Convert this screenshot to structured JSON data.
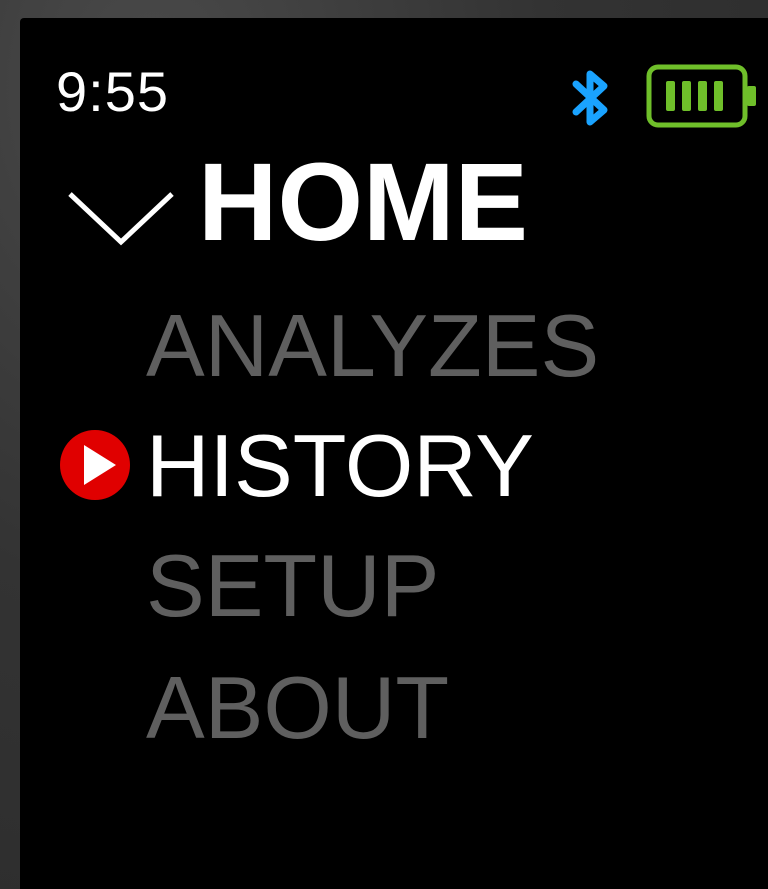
{
  "status_bar": {
    "time": "9:55",
    "bluetooth_icon": "bluetooth-icon",
    "battery_icon": "battery-full-icon",
    "bluetooth_color": "#1aa3ff",
    "battery_color": "#6fbf2a"
  },
  "menu": {
    "header_icon": "chevron-down-icon",
    "title": "HOME",
    "items": [
      {
        "label": "ANALYZES",
        "selected": false
      },
      {
        "label": "HISTORY",
        "selected": true
      },
      {
        "label": "SETUP",
        "selected": false
      },
      {
        "label": "ABOUT",
        "selected": false
      }
    ],
    "selection_icon": "play-icon",
    "selection_color": "#e00000",
    "active_color": "#ffffff",
    "inactive_color": "#5f5f5f"
  }
}
